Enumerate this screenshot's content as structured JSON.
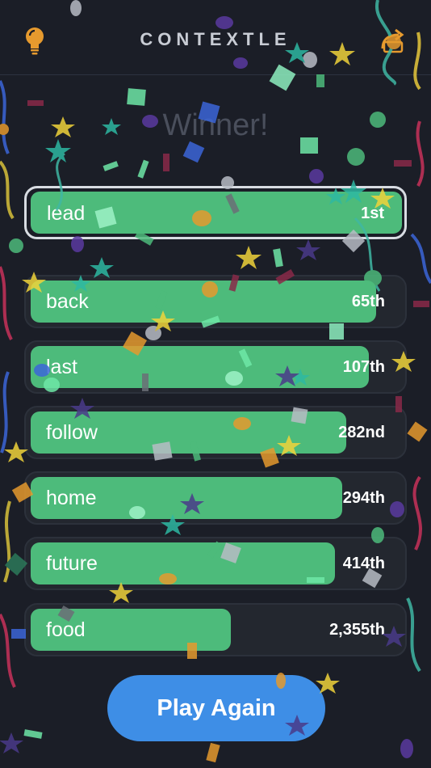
{
  "header": {
    "title": "CONTEXTLE",
    "hint_icon": "lightbulb-icon",
    "share_icon": "share-icon"
  },
  "status": {
    "message": "Winner!"
  },
  "guesses": [
    {
      "word": "lead",
      "rank": "1st",
      "closeness": 1.0,
      "current": true
    },
    {
      "word": "back",
      "rank": "65th",
      "closeness": 0.93
    },
    {
      "word": "last",
      "rank": "107th",
      "closeness": 0.91
    },
    {
      "word": "follow",
      "rank": "282nd",
      "closeness": 0.85
    },
    {
      "word": "home",
      "rank": "294th",
      "closeness": 0.84
    },
    {
      "word": "future",
      "rank": "414th",
      "closeness": 0.82
    },
    {
      "word": "food",
      "rank": "2,355th",
      "closeness": 0.54
    }
  ],
  "actions": {
    "play_again": "Play Again"
  },
  "colors": {
    "background": "#1b1e27",
    "bar_green": "#4dbb7b",
    "button_blue": "#3e8ee6",
    "accent_orange": "#e69a2e"
  }
}
